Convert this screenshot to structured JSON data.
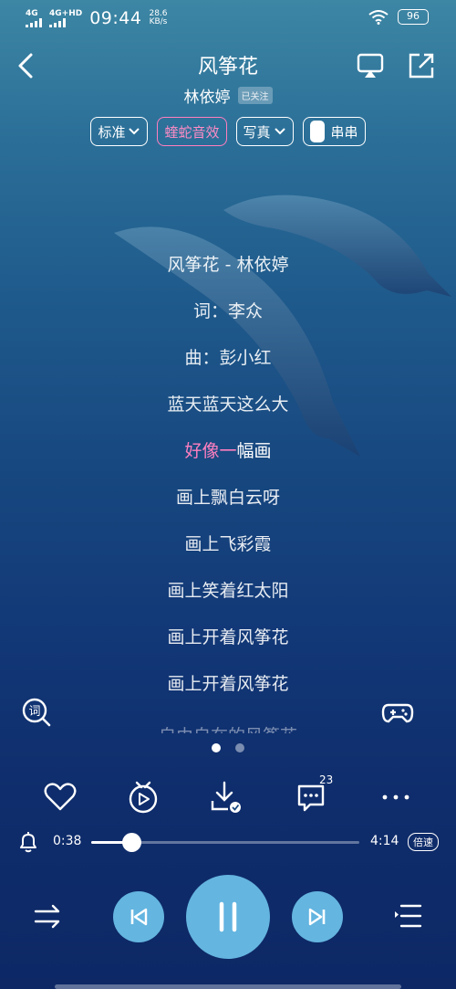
{
  "status_bar": {
    "net1": "4G",
    "net2": "4G+HD",
    "time": "09:44",
    "speed_value": "28.6",
    "speed_unit": "KB/s",
    "battery": "96"
  },
  "header": {
    "title": "风筝花",
    "artist": "林依婷",
    "follow_label": "已关注"
  },
  "chips": {
    "quality": "标准",
    "effect": "蝰蛇音效",
    "mode": "写真",
    "chuanchuan": "串串"
  },
  "lyrics": {
    "lines": [
      "风筝花 - 林依婷",
      "词：李众",
      "曲：彭小红",
      "蓝天蓝天这么大"
    ],
    "active_sung": "好像一",
    "active_rest": "幅画",
    "lines_after": [
      "画上飘白云呀",
      "画上飞彩霞",
      "画上笑着红太阳",
      "画上开着风筝花",
      "画上开着风筝花",
      "自由自在的风筝花"
    ]
  },
  "comments_count": "23",
  "player": {
    "current_time": "0:38",
    "duration": "4:14",
    "speed_label": "倍速",
    "progress": 0.15
  },
  "colors": {
    "accent_pink": "#ff7fc0",
    "control_blue": "#64b5e0"
  },
  "icons": [
    "back-icon",
    "airplay-icon",
    "share-icon",
    "lyrics-search-icon",
    "gamepad-icon",
    "heart-icon",
    "video-icon",
    "download-icon",
    "comment-icon",
    "more-icon",
    "bell-icon",
    "shuffle-icon",
    "prev-icon",
    "pause-icon",
    "next-icon",
    "playlist-icon"
  ]
}
